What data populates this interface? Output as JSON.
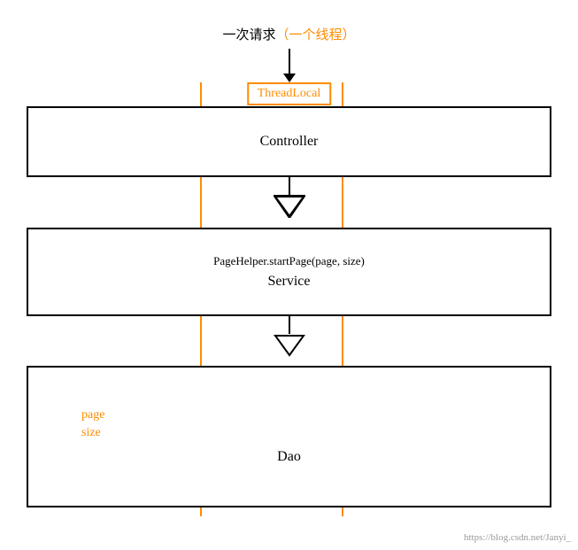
{
  "diagram": {
    "top_label": {
      "text_cn": "一次请求",
      "text_orange": "（一个线程）"
    },
    "threadlocal": {
      "label": "ThreadLocal"
    },
    "controller": {
      "label": "Controller"
    },
    "service": {
      "top_text": "PageHelper.startPage(page, size)",
      "main_label": "Service"
    },
    "dao": {
      "page_label": "page",
      "size_label": "size",
      "main_label": "Dao"
    },
    "watermark": "https://blog.csdn.net/Janyi_"
  }
}
